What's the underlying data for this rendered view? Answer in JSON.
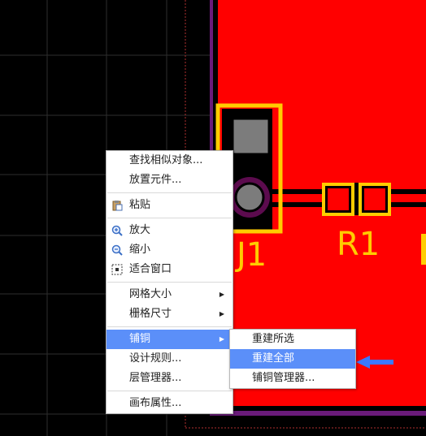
{
  "pcb": {
    "designator": "J1",
    "resistor": "R1"
  },
  "context_menu": {
    "items": [
      {
        "label": "查找相似对象..."
      },
      {
        "label": "放置元件..."
      },
      {
        "label": "粘贴",
        "icon": "paste-icon"
      },
      {
        "label": "放大",
        "icon": "zoom-in-icon"
      },
      {
        "label": "缩小",
        "icon": "zoom-out-icon"
      },
      {
        "label": "适合窗口",
        "icon": "fit-window-icon"
      },
      {
        "label": "网格大小",
        "submenu": true
      },
      {
        "label": "栅格尺寸",
        "submenu": true
      },
      {
        "label": "铺铜",
        "submenu": true,
        "highlighted": true
      },
      {
        "label": "设计规则..."
      },
      {
        "label": "层管理器..."
      },
      {
        "label": "画布属性..."
      }
    ]
  },
  "copper_submenu": {
    "items": [
      {
        "label": "重建所选"
      },
      {
        "label": "重建全部",
        "highlighted": true
      },
      {
        "label": "铺铜管理器..."
      }
    ]
  },
  "colors": {
    "copper_pour": "#ff0000",
    "silkscreen": "#ffcc00",
    "board_outline": "#6a1b7a",
    "menu_highlight": "#5b8ff9",
    "pointer_arrow": "#3c78ff"
  }
}
